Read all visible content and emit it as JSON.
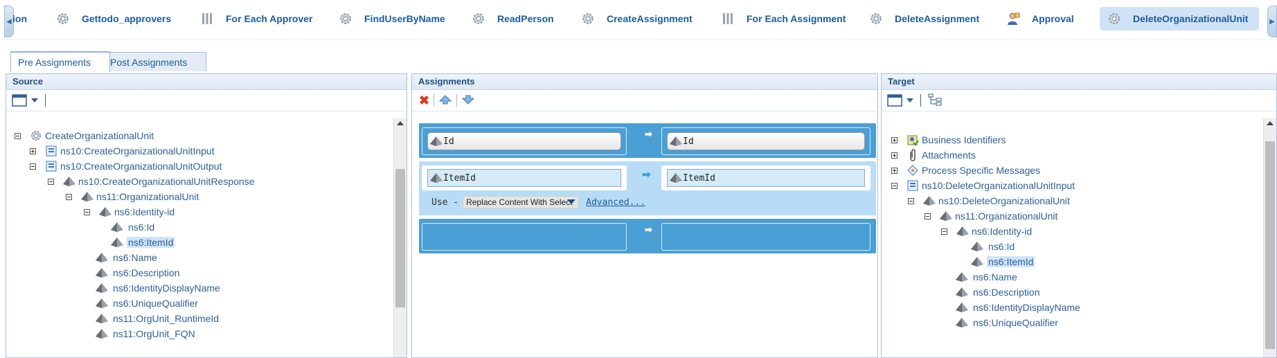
{
  "steps": [
    {
      "label": "ion",
      "icon": "gear-icon"
    },
    {
      "label": "Gettodo_approvers",
      "icon": "gear-icon"
    },
    {
      "label": "For Each Approver",
      "icon": "loop-bars-icon"
    },
    {
      "label": "FindUserByName",
      "icon": "gear-icon"
    },
    {
      "label": "ReadPerson",
      "icon": "gear-icon"
    },
    {
      "label": "CreateAssignment",
      "icon": "gear-icon"
    },
    {
      "label": "For Each Assignment",
      "icon": "loop-bars-icon"
    },
    {
      "label": "DeleteAssignment",
      "icon": "gear-icon"
    },
    {
      "label": "Approval",
      "icon": "person-approval-icon"
    },
    {
      "label": "DeleteOrganizationalUnit",
      "icon": "gear-icon"
    }
  ],
  "tabs": {
    "pre": "Pre Assignments",
    "post": "Post Assignments"
  },
  "source": {
    "title": "Source",
    "nodes": [
      {
        "label": "CreateOrganizationalUnit",
        "icon": "gear-icon",
        "exp": "minus"
      },
      {
        "label": "ns10:CreateOrganizationalUnitInput",
        "icon": "message-icon",
        "exp": "plus"
      },
      {
        "label": "ns10:CreateOrganizationalUnitOutput",
        "icon": "message-icon",
        "exp": "minus"
      },
      {
        "label": "ns10:CreateOrganizationalUnitResponse",
        "icon": "element-icon",
        "exp": "minus"
      },
      {
        "label": "ns11:OrganizationalUnit",
        "icon": "element-icon",
        "exp": "minus"
      },
      {
        "label": "ns6:Identity-id",
        "icon": "element-icon",
        "exp": "minus"
      },
      {
        "label": "ns6:Id",
        "icon": "element-icon",
        "exp": "none"
      },
      {
        "label": "ns6:ItemId",
        "icon": "element-icon",
        "exp": "none",
        "selected": true
      },
      {
        "label": "ns6:Name",
        "icon": "element-icon",
        "exp": "none"
      },
      {
        "label": "ns6:Description",
        "icon": "element-icon",
        "exp": "none"
      },
      {
        "label": "ns6:IdentityDisplayName",
        "icon": "element-icon",
        "exp": "none"
      },
      {
        "label": "ns6:UniqueQualifier",
        "icon": "element-icon",
        "exp": "none"
      },
      {
        "label": "ns11:OrgUnit_RuntimeId",
        "icon": "element-icon",
        "exp": "none"
      },
      {
        "label": "ns11:OrgUnit_FQN",
        "icon": "element-icon",
        "exp": "none"
      }
    ]
  },
  "assignments": {
    "title": "Assignments",
    "rows": [
      {
        "from": "Id",
        "to": "Id"
      },
      {
        "from": "ItemId",
        "to": "ItemId",
        "use_label": "Use -",
        "use_value": "Replace Content With Select",
        "advanced": "Advanced..."
      },
      {
        "from": "",
        "to": ""
      }
    ]
  },
  "target": {
    "title": "Target",
    "nodes": [
      {
        "label": "Business Identifiers",
        "icon": "business-id-icon",
        "exp": "plus"
      },
      {
        "label": "Attachments",
        "icon": "paperclip-icon",
        "exp": "plus"
      },
      {
        "label": "Process Specific Messages",
        "icon": "process-message-icon",
        "exp": "plus"
      },
      {
        "label": "ns10:DeleteOrganizationalUnitInput",
        "icon": "message-icon",
        "exp": "minus"
      },
      {
        "label": "ns10:DeleteOrganizationalUnit",
        "icon": "element-icon",
        "exp": "minus"
      },
      {
        "label": "ns11:OrganizationalUnit",
        "icon": "element-icon",
        "exp": "minus"
      },
      {
        "label": "ns6:Identity-id",
        "icon": "element-icon",
        "exp": "minus"
      },
      {
        "label": "ns6:Id",
        "icon": "element-icon",
        "exp": "none"
      },
      {
        "label": "ns6:ItemId",
        "icon": "element-icon",
        "exp": "none",
        "selected": true
      },
      {
        "label": "ns6:Name",
        "icon": "element-icon",
        "exp": "none"
      },
      {
        "label": "ns6:Description",
        "icon": "element-icon",
        "exp": "none"
      },
      {
        "label": "ns6:IdentityDisplayName",
        "icon": "element-icon",
        "exp": "none"
      },
      {
        "label": "ns6:UniqueQualifier",
        "icon": "element-icon",
        "exp": "none"
      }
    ]
  }
}
